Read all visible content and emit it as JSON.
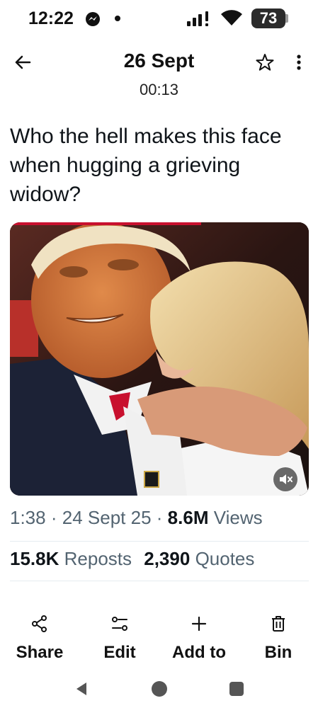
{
  "status_bar": {
    "time": "12:22",
    "battery": "73"
  },
  "header": {
    "title": "26 Sept",
    "subtitle": "00:13"
  },
  "post": {
    "text": "Who the hell makes this face when hugging a grieving widow?",
    "media": {
      "type": "video",
      "mute_icon": "volume-muted-icon"
    }
  },
  "meta": {
    "time": "1:38",
    "sep1": "·",
    "date": "24 Sept 25",
    "sep2": "·",
    "views_count": "8.6M",
    "views_label": "Views"
  },
  "stats": {
    "reposts_count": "15.8K",
    "reposts_label": "Reposts",
    "quotes_count": "2,390",
    "quotes_label": "Quotes"
  },
  "actions": {
    "share": "Share",
    "edit": "Edit",
    "add_to": "Add to",
    "bin": "Bin"
  },
  "colors": {
    "secondary_text": "#536471",
    "divider": "#e6ecf0"
  }
}
